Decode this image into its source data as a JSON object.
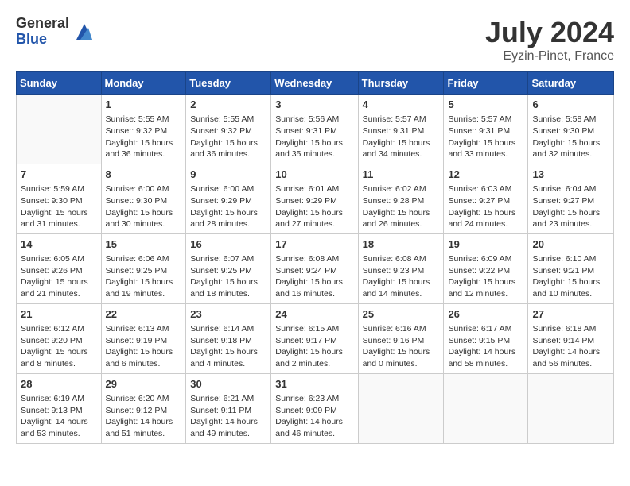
{
  "logo": {
    "general": "General",
    "blue": "Blue"
  },
  "calendar": {
    "title": "July 2024",
    "subtitle": "Eyzin-Pinet, France"
  },
  "headers": [
    "Sunday",
    "Monday",
    "Tuesday",
    "Wednesday",
    "Thursday",
    "Friday",
    "Saturday"
  ],
  "weeks": [
    [
      {
        "day": "",
        "info": ""
      },
      {
        "day": "1",
        "info": "Sunrise: 5:55 AM\nSunset: 9:32 PM\nDaylight: 15 hours and 36 minutes."
      },
      {
        "day": "2",
        "info": "Sunrise: 5:55 AM\nSunset: 9:32 PM\nDaylight: 15 hours and 36 minutes."
      },
      {
        "day": "3",
        "info": "Sunrise: 5:56 AM\nSunset: 9:31 PM\nDaylight: 15 hours and 35 minutes."
      },
      {
        "day": "4",
        "info": "Sunrise: 5:57 AM\nSunset: 9:31 PM\nDaylight: 15 hours and 34 minutes."
      },
      {
        "day": "5",
        "info": "Sunrise: 5:57 AM\nSunset: 9:31 PM\nDaylight: 15 hours and 33 minutes."
      },
      {
        "day": "6",
        "info": "Sunrise: 5:58 AM\nSunset: 9:30 PM\nDaylight: 15 hours and 32 minutes."
      }
    ],
    [
      {
        "day": "7",
        "info": "Sunrise: 5:59 AM\nSunset: 9:30 PM\nDaylight: 15 hours and 31 minutes."
      },
      {
        "day": "8",
        "info": "Sunrise: 6:00 AM\nSunset: 9:30 PM\nDaylight: 15 hours and 30 minutes."
      },
      {
        "day": "9",
        "info": "Sunrise: 6:00 AM\nSunset: 9:29 PM\nDaylight: 15 hours and 28 minutes."
      },
      {
        "day": "10",
        "info": "Sunrise: 6:01 AM\nSunset: 9:29 PM\nDaylight: 15 hours and 27 minutes."
      },
      {
        "day": "11",
        "info": "Sunrise: 6:02 AM\nSunset: 9:28 PM\nDaylight: 15 hours and 26 minutes."
      },
      {
        "day": "12",
        "info": "Sunrise: 6:03 AM\nSunset: 9:27 PM\nDaylight: 15 hours and 24 minutes."
      },
      {
        "day": "13",
        "info": "Sunrise: 6:04 AM\nSunset: 9:27 PM\nDaylight: 15 hours and 23 minutes."
      }
    ],
    [
      {
        "day": "14",
        "info": "Sunrise: 6:05 AM\nSunset: 9:26 PM\nDaylight: 15 hours and 21 minutes."
      },
      {
        "day": "15",
        "info": "Sunrise: 6:06 AM\nSunset: 9:25 PM\nDaylight: 15 hours and 19 minutes."
      },
      {
        "day": "16",
        "info": "Sunrise: 6:07 AM\nSunset: 9:25 PM\nDaylight: 15 hours and 18 minutes."
      },
      {
        "day": "17",
        "info": "Sunrise: 6:08 AM\nSunset: 9:24 PM\nDaylight: 15 hours and 16 minutes."
      },
      {
        "day": "18",
        "info": "Sunrise: 6:08 AM\nSunset: 9:23 PM\nDaylight: 15 hours and 14 minutes."
      },
      {
        "day": "19",
        "info": "Sunrise: 6:09 AM\nSunset: 9:22 PM\nDaylight: 15 hours and 12 minutes."
      },
      {
        "day": "20",
        "info": "Sunrise: 6:10 AM\nSunset: 9:21 PM\nDaylight: 15 hours and 10 minutes."
      }
    ],
    [
      {
        "day": "21",
        "info": "Sunrise: 6:12 AM\nSunset: 9:20 PM\nDaylight: 15 hours and 8 minutes."
      },
      {
        "day": "22",
        "info": "Sunrise: 6:13 AM\nSunset: 9:19 PM\nDaylight: 15 hours and 6 minutes."
      },
      {
        "day": "23",
        "info": "Sunrise: 6:14 AM\nSunset: 9:18 PM\nDaylight: 15 hours and 4 minutes."
      },
      {
        "day": "24",
        "info": "Sunrise: 6:15 AM\nSunset: 9:17 PM\nDaylight: 15 hours and 2 minutes."
      },
      {
        "day": "25",
        "info": "Sunrise: 6:16 AM\nSunset: 9:16 PM\nDaylight: 15 hours and 0 minutes."
      },
      {
        "day": "26",
        "info": "Sunrise: 6:17 AM\nSunset: 9:15 PM\nDaylight: 14 hours and 58 minutes."
      },
      {
        "day": "27",
        "info": "Sunrise: 6:18 AM\nSunset: 9:14 PM\nDaylight: 14 hours and 56 minutes."
      }
    ],
    [
      {
        "day": "28",
        "info": "Sunrise: 6:19 AM\nSunset: 9:13 PM\nDaylight: 14 hours and 53 minutes."
      },
      {
        "day": "29",
        "info": "Sunrise: 6:20 AM\nSunset: 9:12 PM\nDaylight: 14 hours and 51 minutes."
      },
      {
        "day": "30",
        "info": "Sunrise: 6:21 AM\nSunset: 9:11 PM\nDaylight: 14 hours and 49 minutes."
      },
      {
        "day": "31",
        "info": "Sunrise: 6:23 AM\nSunset: 9:09 PM\nDaylight: 14 hours and 46 minutes."
      },
      {
        "day": "",
        "info": ""
      },
      {
        "day": "",
        "info": ""
      },
      {
        "day": "",
        "info": ""
      }
    ]
  ]
}
